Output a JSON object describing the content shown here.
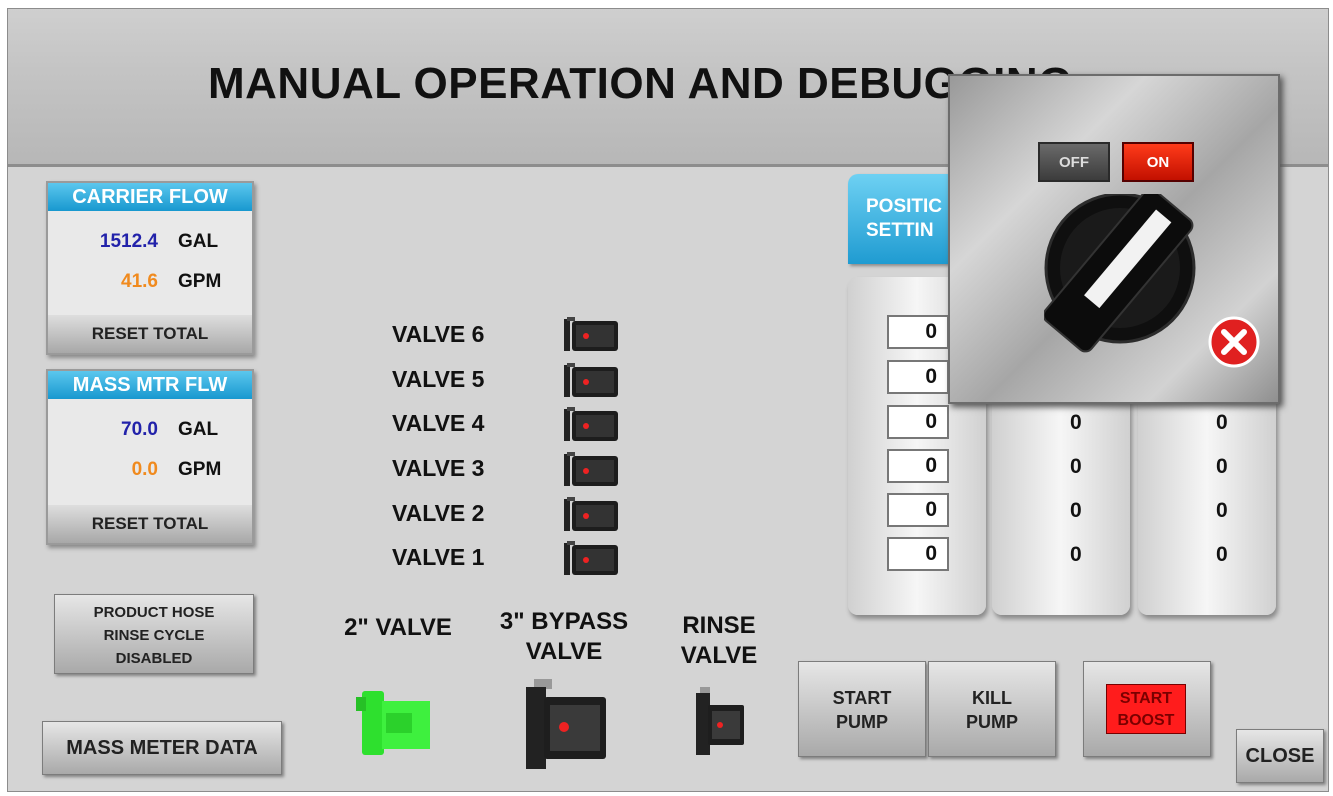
{
  "header": {
    "title": "MANUAL OPERATION AND DEBUGGING"
  },
  "carrier_flow": {
    "title": "CARRIER FLOW",
    "total": "1512.4",
    "total_unit": "GAL",
    "rate": "41.6",
    "rate_unit": "GPM",
    "reset_label": "RESET TOTAL"
  },
  "mass_meter_flow": {
    "title": "MASS MTR FLW",
    "total": "70.0",
    "total_unit": "GAL",
    "rate": "0.0",
    "rate_unit": "GPM",
    "reset_label": "RESET TOTAL"
  },
  "valves": [
    "VALVE 6",
    "VALVE 5",
    "VALVE 4",
    "VALVE 3",
    "VALVE 2",
    "VALVE 1"
  ],
  "rinse_status": {
    "line1": "PRODUCT HOSE",
    "line2": "RINSE CYCLE",
    "line3": "DISABLED"
  },
  "mass_meter_button": "MASS METER DATA",
  "bottom_valves": {
    "two_inch": "2\" VALVE",
    "bypass_line1": "3\" BYPASS",
    "bypass_line2": "VALVE",
    "rinse_line1": "RINSE",
    "rinse_line2": "VALVE"
  },
  "position_settings": {
    "tab_line1": "POSITIC",
    "tab_line2": "SETTIN",
    "col1": [
      "0",
      "0",
      "0",
      "0",
      "0",
      "0"
    ],
    "col2": [
      "0",
      "0",
      "0",
      "0"
    ],
    "col3": [
      "0",
      "0",
      "0",
      "0"
    ]
  },
  "pump_buttons": {
    "start_pump_1": "START",
    "start_pump_2": "PUMP",
    "kill_pump_1": "KILL",
    "kill_pump_2": "PUMP",
    "start_boost_1": "START",
    "start_boost_2": "BOOST"
  },
  "close_button": "CLOSE",
  "selector_switch": {
    "off_label": "OFF",
    "on_label": "ON",
    "state": "ON"
  },
  "colors": {
    "accent_blue": "#1898cf",
    "valve_open": "#2ee02e",
    "boost_red": "#ff1c1c"
  }
}
